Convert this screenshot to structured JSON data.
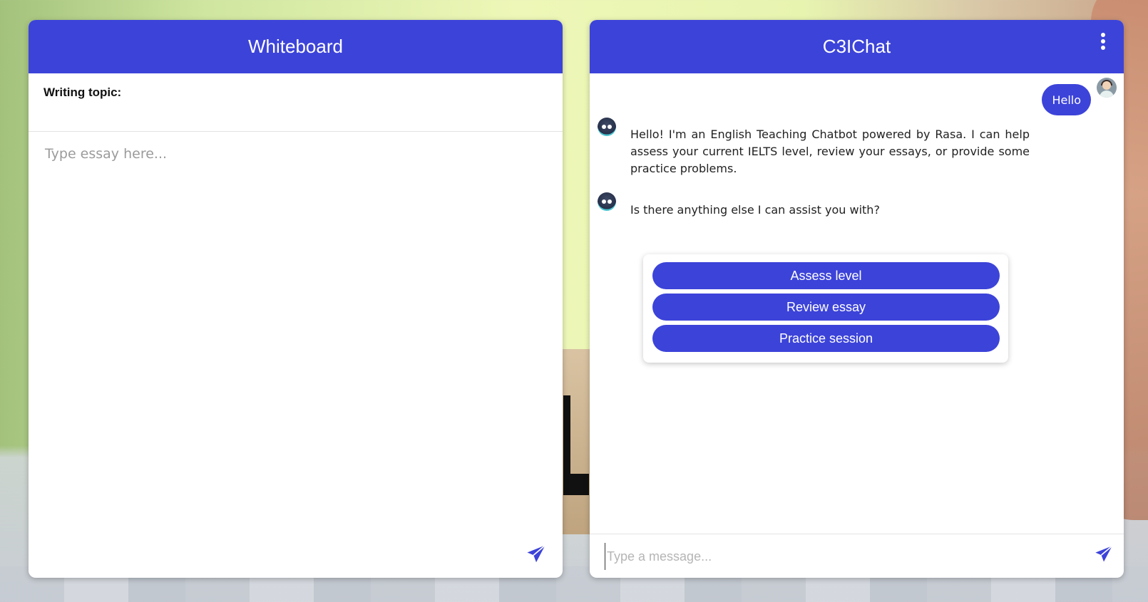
{
  "colors": {
    "accent": "#3c43d9",
    "panel_bg": "#ffffff"
  },
  "whiteboard": {
    "title": "Whiteboard",
    "topic_label": "Writing topic:",
    "essay_placeholder": "Type essay here...",
    "send_icon": "send-icon"
  },
  "chat": {
    "title": "C3IChat",
    "menu_icon": "more-vertical-icon",
    "messages": [
      {
        "sender": "user",
        "text": "Hello"
      },
      {
        "sender": "bot",
        "text": "Hello! I'm an English Teaching Chatbot powered by Rasa. I can help assess your current IELTS level, review your essays, or provide some practice problems."
      },
      {
        "sender": "bot",
        "text": "Is there anything else I can assist you with?"
      }
    ],
    "quick_replies": [
      "Assess level",
      "Review essay",
      "Practice session"
    ],
    "input_placeholder": "Type a message...",
    "send_icon": "send-icon"
  }
}
